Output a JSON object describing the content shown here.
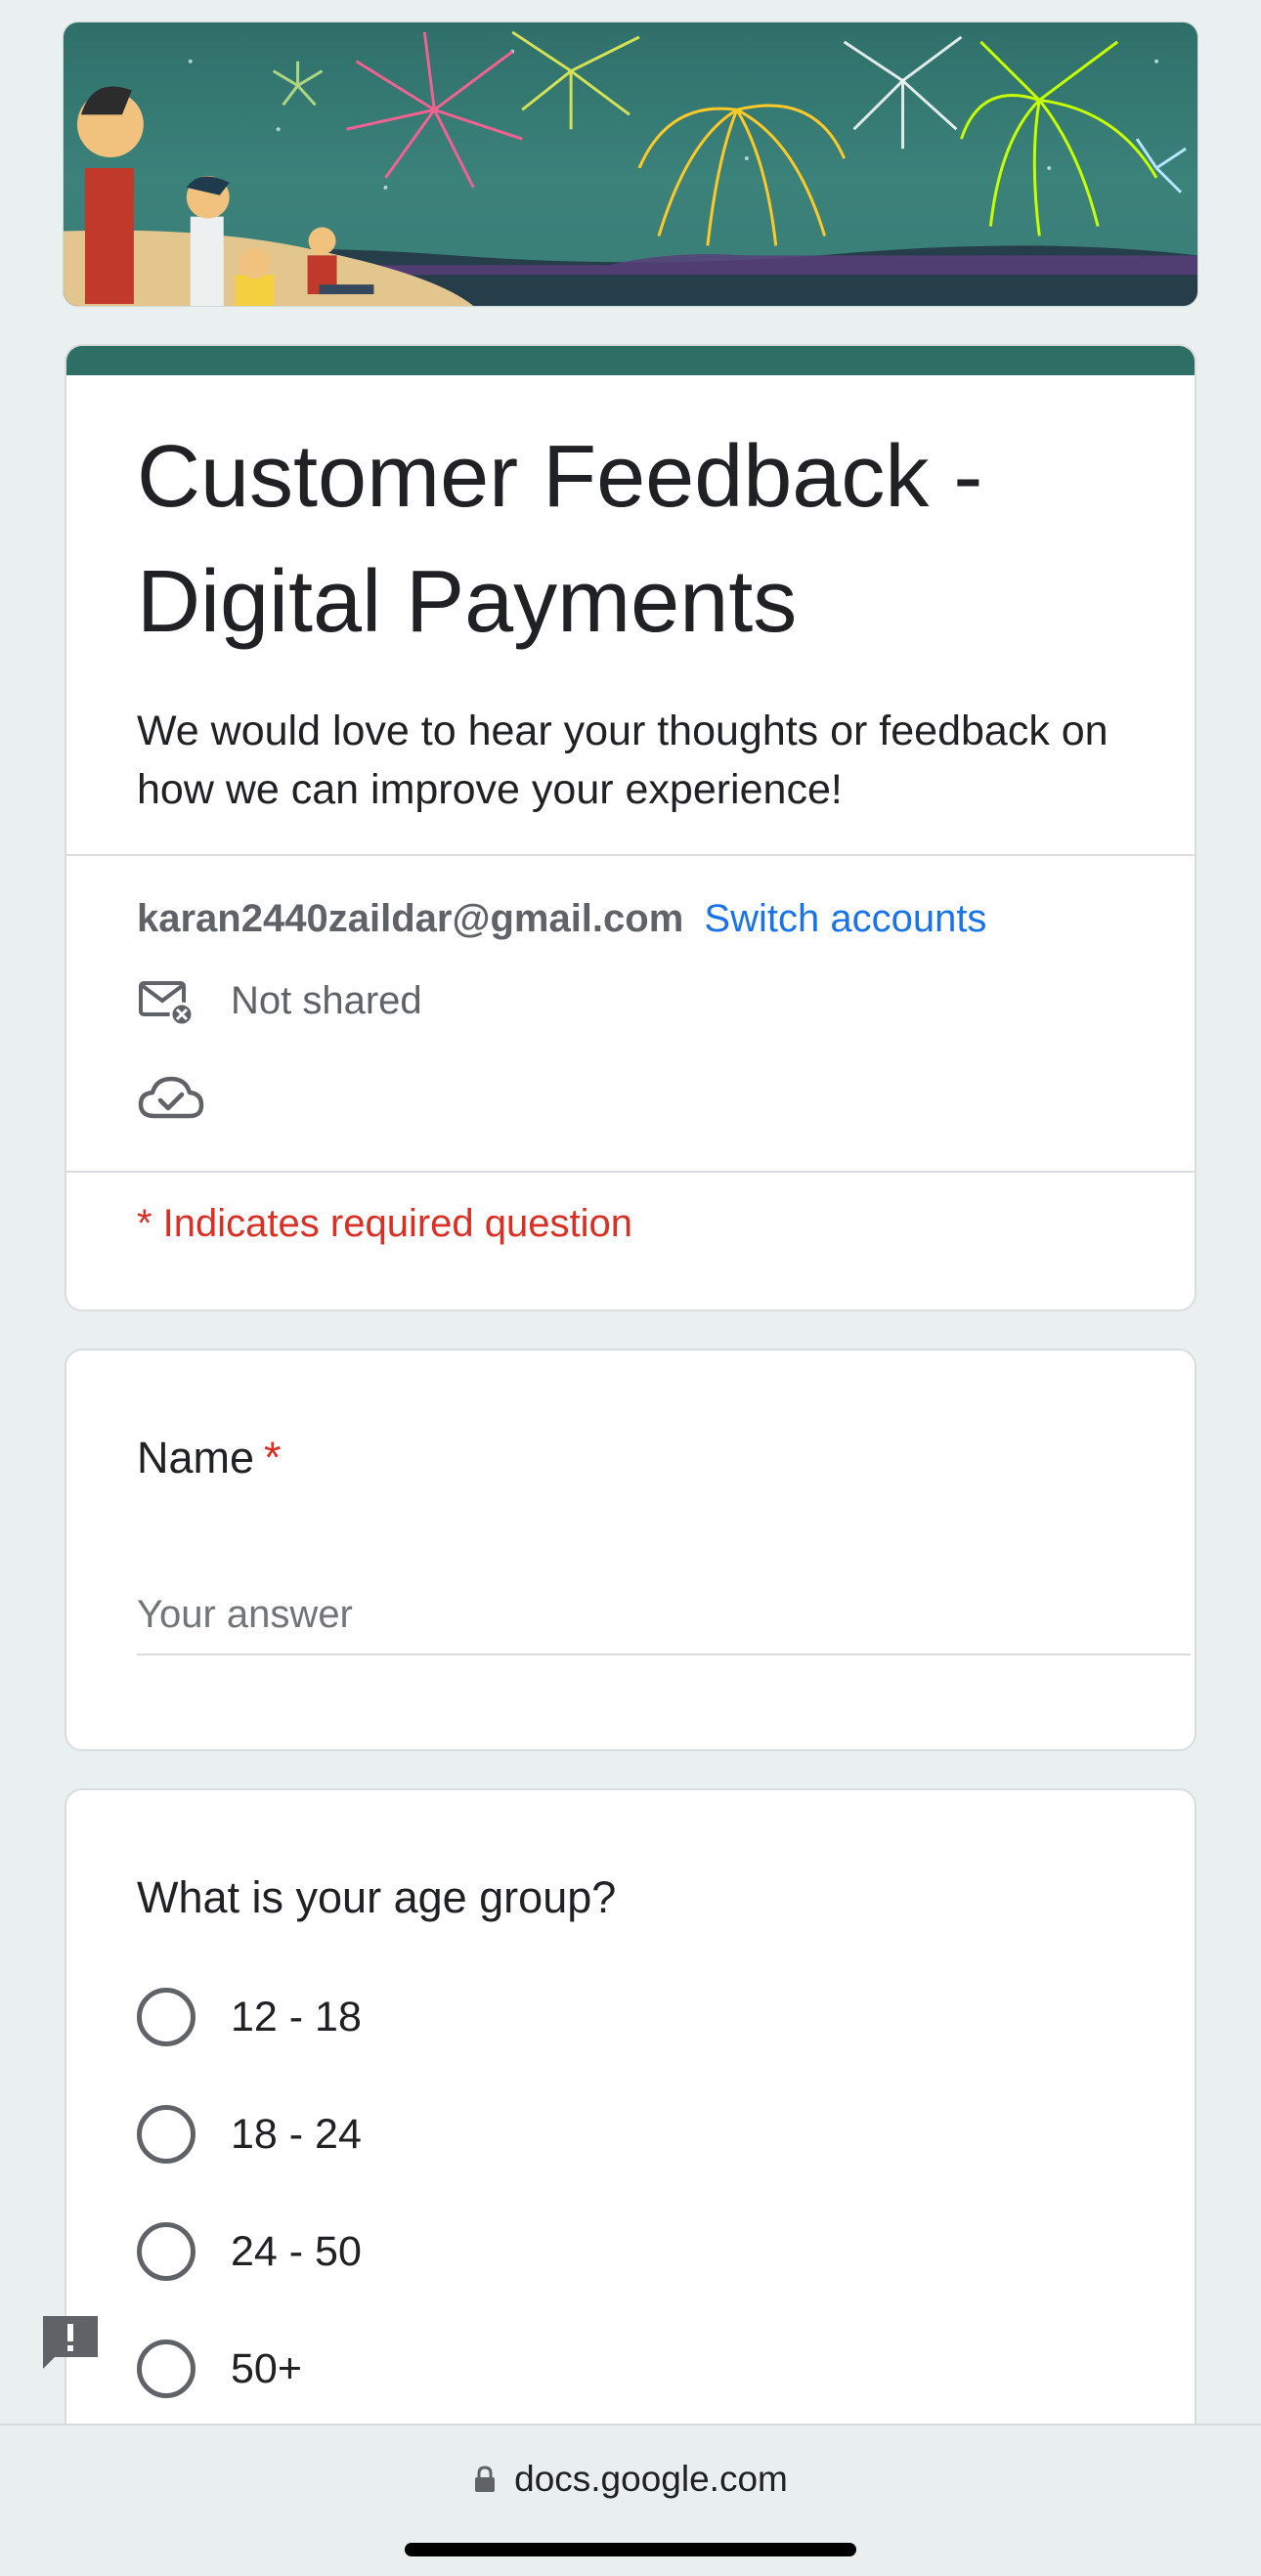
{
  "header": {
    "title": "Customer Feedback - Digital Payments",
    "description": "We would love to hear your thoughts or feedback on how we can improve your experience!",
    "accent_color": "#2f6e65"
  },
  "account": {
    "email": "karan2440zaildar@gmail.com",
    "switch_label": "Switch accounts",
    "email_status": "Not shared"
  },
  "required_note": "* Indicates required question",
  "questions": {
    "name": {
      "label": "Name",
      "required_mark": "*",
      "placeholder": "Your answer"
    },
    "age": {
      "label": "What is your age group?",
      "options": [
        "12 - 18",
        "18 - 24",
        "24 - 50",
        "50+"
      ]
    }
  },
  "browser": {
    "url": "docs.google.com"
  },
  "icons": {
    "mail": "mail-x-icon",
    "cloud": "cloud-check-icon",
    "feedback": "report-feedback-icon",
    "lock": "lock-icon"
  }
}
